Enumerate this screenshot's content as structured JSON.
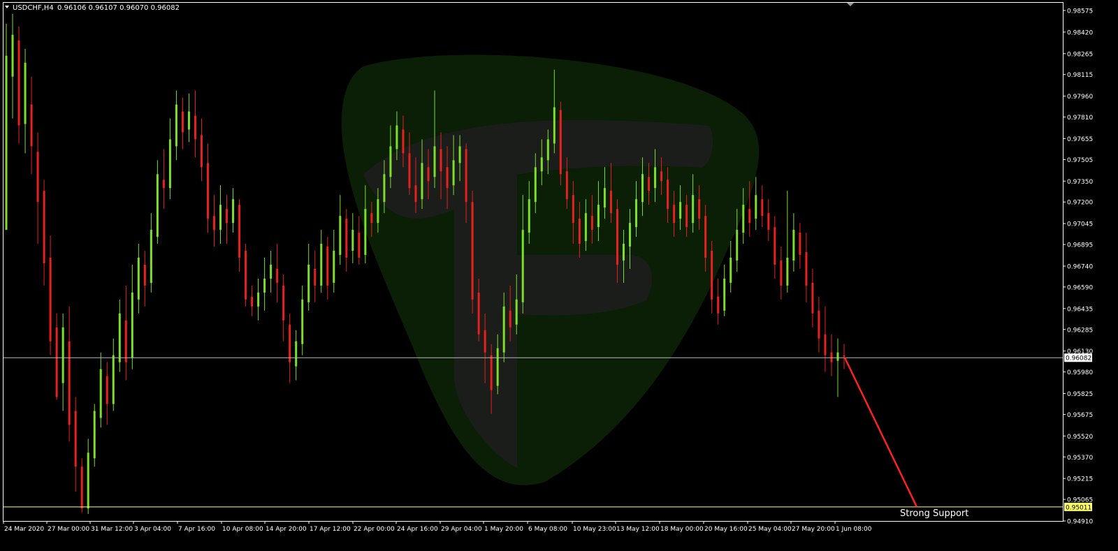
{
  "header": {
    "symbol_timeframe": "USDCHF,H4",
    "ohlc": "0.96106 0.96107 0.96070 0.96082"
  },
  "colors": {
    "background": "#000000",
    "frame": "#ffffff",
    "text": "#ffffff",
    "bull": "#7ddf2c",
    "bear": "#e8201e",
    "bid_line": "#b8b8b8",
    "support_line": "#ffff66",
    "projection": "#ff2020",
    "watermark_shield": "#0b2207",
    "watermark_letter": "#1d1d1d"
  },
  "watermark": {
    "icon": "shield-p-logo-icon"
  },
  "chart_data": {
    "type": "candlestick",
    "symbol": "USDCHF",
    "timeframe": "H4",
    "ylim": [
      0.9491,
      0.98575
    ],
    "y_ticks": [
      "0.98575",
      "0.98420",
      "0.98265",
      "0.98115",
      "0.97960",
      "0.97810",
      "0.97655",
      "0.97505",
      "0.97350",
      "0.97200",
      "0.97045",
      "0.96895",
      "0.96740",
      "0.96590",
      "0.96435",
      "0.96285",
      "0.96130",
      "0.95980",
      "0.95825",
      "0.95675",
      "0.95520",
      "0.95370",
      "0.95215",
      "0.95065",
      "0.94910"
    ],
    "x_labels": [
      "24 Mar 2020",
      "27 Mar 00:00",
      "31 Mar 12:00",
      "3 Apr 04:00",
      "7 Apr 16:00",
      "10 Apr 08:00",
      "14 Apr 20:00",
      "17 Apr 12:00",
      "22 Apr 00:00",
      "24 Apr 16:00",
      "29 Apr 04:00",
      "1 May 20:00",
      "6 May 08:00",
      "10 May 23:00",
      "13 May 12:00",
      "18 May 00:00",
      "20 May 16:00",
      "25 May 04:00",
      "27 May 20:00",
      "1 Jun 08:00"
    ],
    "bid_price": "0.96082",
    "support_price": "0.95011",
    "support_label": "Strong Support",
    "projection": {
      "from_price": 0.96082,
      "to_price": 0.95011
    },
    "candles": [
      [
        0.97,
        0.9825,
        0.9725,
        0.9848,
        0.9712
      ],
      [
        0.981,
        0.984,
        0.9794,
        0.9855,
        0.978
      ],
      [
        0.9836,
        0.9775,
        0.9786,
        0.9846,
        0.9762
      ],
      [
        0.9776,
        0.982,
        0.976,
        0.983,
        0.9755
      ],
      [
        0.979,
        0.976,
        0.9745,
        0.981,
        0.974
      ],
      [
        0.9756,
        0.972,
        0.9705,
        0.977,
        0.969
      ],
      [
        0.9728,
        0.9676,
        0.9688,
        0.9736,
        0.966
      ],
      [
        0.968,
        0.962,
        0.9632,
        0.9696,
        0.961
      ],
      [
        0.963,
        0.958,
        0.9592,
        0.964,
        0.9578
      ],
      [
        0.959,
        0.963,
        0.9615,
        0.964,
        0.957
      ],
      [
        0.962,
        0.956,
        0.9575,
        0.9645,
        0.9548
      ],
      [
        0.957,
        0.953,
        0.9518,
        0.958,
        0.9512
      ],
      [
        0.953,
        0.95,
        0.9505,
        0.9536,
        0.9497
      ],
      [
        0.95,
        0.954,
        0.9528,
        0.955,
        0.9496
      ],
      [
        0.9536,
        0.957,
        0.956,
        0.9575,
        0.953
      ],
      [
        0.9565,
        0.96,
        0.959,
        0.9612,
        0.9558
      ],
      [
        0.9595,
        0.9575,
        0.9568,
        0.9605,
        0.956
      ],
      [
        0.9575,
        0.961,
        0.9598,
        0.9622,
        0.957
      ],
      [
        0.9605,
        0.964,
        0.9628,
        0.965,
        0.9598
      ],
      [
        0.9635,
        0.9605,
        0.9595,
        0.966,
        0.9592
      ],
      [
        0.9608,
        0.9655,
        0.964,
        0.9675,
        0.96
      ],
      [
        0.965,
        0.968,
        0.9668,
        0.969,
        0.964
      ],
      [
        0.9675,
        0.966,
        0.965,
        0.9685,
        0.9645
      ],
      [
        0.9662,
        0.97,
        0.9688,
        0.9712,
        0.9655
      ],
      [
        0.9695,
        0.974,
        0.9728,
        0.975,
        0.969
      ],
      [
        0.9736,
        0.973,
        0.972,
        0.9758,
        0.9715
      ],
      [
        0.973,
        0.9765,
        0.9752,
        0.978,
        0.9722
      ],
      [
        0.976,
        0.979,
        0.978,
        0.98,
        0.975
      ],
      [
        0.9785,
        0.977,
        0.976,
        0.9795,
        0.9758
      ],
      [
        0.9772,
        0.9785,
        0.979,
        0.9798,
        0.9763
      ],
      [
        0.9782,
        0.9765,
        0.9772,
        0.98,
        0.9752
      ],
      [
        0.9768,
        0.9745,
        0.9738,
        0.978,
        0.9735
      ],
      [
        0.9748,
        0.9708,
        0.9718,
        0.9762,
        0.9698
      ],
      [
        0.971,
        0.97,
        0.9692,
        0.9725,
        0.9688
      ],
      [
        0.97,
        0.9718,
        0.9708,
        0.9732,
        0.969
      ],
      [
        0.9715,
        0.9705,
        0.9698,
        0.9725,
        0.969
      ],
      [
        0.9705,
        0.9722,
        0.9712,
        0.973,
        0.9698
      ],
      [
        0.9718,
        0.968,
        0.9692,
        0.9722,
        0.967
      ],
      [
        0.9685,
        0.965,
        0.9658,
        0.969,
        0.9645
      ],
      [
        0.9652,
        0.9645,
        0.964,
        0.966,
        0.9638
      ],
      [
        0.9645,
        0.9655,
        0.965,
        0.9665,
        0.9635
      ],
      [
        0.9655,
        0.9665,
        0.966,
        0.968,
        0.9642
      ],
      [
        0.9665,
        0.9675,
        0.9668,
        0.9685,
        0.9655
      ],
      [
        0.9672,
        0.9662,
        0.9655,
        0.969,
        0.9648
      ],
      [
        0.966,
        0.9635,
        0.9625,
        0.9668,
        0.962
      ],
      [
        0.9632,
        0.9605,
        0.9595,
        0.964,
        0.959
      ],
      [
        0.9602,
        0.962,
        0.9612,
        0.9628,
        0.9592
      ],
      [
        0.9618,
        0.965,
        0.964,
        0.966,
        0.961
      ],
      [
        0.9648,
        0.9675,
        0.9668,
        0.969,
        0.9642
      ],
      [
        0.9672,
        0.966,
        0.9652,
        0.9685,
        0.9648
      ],
      [
        0.966,
        0.969,
        0.9682,
        0.97,
        0.9655
      ],
      [
        0.9688,
        0.966,
        0.9668,
        0.9695,
        0.965
      ],
      [
        0.9662,
        0.9685,
        0.9678,
        0.97,
        0.9655
      ],
      [
        0.9682,
        0.971,
        0.97,
        0.9725,
        0.9675
      ],
      [
        0.9708,
        0.968,
        0.969,
        0.9715,
        0.967
      ],
      [
        0.9685,
        0.97,
        0.9692,
        0.9712,
        0.9676
      ],
      [
        0.9698,
        0.968,
        0.9688,
        0.971,
        0.9675
      ],
      [
        0.9682,
        0.9715,
        0.9705,
        0.9732,
        0.9676
      ],
      [
        0.9712,
        0.9705,
        0.97,
        0.972,
        0.9695
      ],
      [
        0.9705,
        0.9722,
        0.9715,
        0.973,
        0.9698
      ],
      [
        0.972,
        0.974,
        0.9732,
        0.975,
        0.9712
      ],
      [
        0.9738,
        0.976,
        0.9752,
        0.9775,
        0.973
      ],
      [
        0.9758,
        0.9775,
        0.9768,
        0.9785,
        0.975
      ],
      [
        0.9772,
        0.9755,
        0.9762,
        0.9782,
        0.9745
      ],
      [
        0.9755,
        0.973,
        0.974,
        0.977,
        0.9725
      ],
      [
        0.9732,
        0.972,
        0.9725,
        0.9752,
        0.9712
      ],
      [
        0.9722,
        0.9748,
        0.974,
        0.9765,
        0.9715
      ],
      [
        0.9745,
        0.9735,
        0.9728,
        0.9758,
        0.9722
      ],
      [
        0.9738,
        0.976,
        0.9752,
        0.98,
        0.973
      ],
      [
        0.9758,
        0.9742,
        0.9735,
        0.977,
        0.9722
      ],
      [
        0.9745,
        0.973,
        0.972,
        0.976,
        0.9715
      ],
      [
        0.9732,
        0.975,
        0.9742,
        0.9768,
        0.9725
      ],
      [
        0.9748,
        0.976,
        0.975,
        0.9768,
        0.9735
      ],
      [
        0.9758,
        0.972,
        0.973,
        0.9762,
        0.9705
      ],
      [
        0.972,
        0.965,
        0.9665,
        0.9728,
        0.964
      ],
      [
        0.9655,
        0.9625,
        0.963,
        0.9665,
        0.962
      ],
      [
        0.9628,
        0.9612,
        0.9605,
        0.964,
        0.959
      ],
      [
        0.961,
        0.9585,
        0.9592,
        0.9618,
        0.9568
      ],
      [
        0.9588,
        0.9615,
        0.9605,
        0.9625,
        0.9582
      ],
      [
        0.9612,
        0.9645,
        0.9635,
        0.9655,
        0.9605
      ],
      [
        0.9642,
        0.963,
        0.9625,
        0.966,
        0.962
      ],
      [
        0.9632,
        0.965,
        0.9642,
        0.9668,
        0.9625
      ],
      [
        0.9648,
        0.97,
        0.969,
        0.9725,
        0.964
      ],
      [
        0.9698,
        0.9722,
        0.9715,
        0.9735,
        0.969
      ],
      [
        0.972,
        0.9745,
        0.9735,
        0.9755,
        0.9712
      ],
      [
        0.9742,
        0.9752,
        0.9745,
        0.9765,
        0.9732
      ],
      [
        0.975,
        0.9765,
        0.9755,
        0.9772,
        0.974
      ],
      [
        0.9762,
        0.9788,
        0.978,
        0.9815,
        0.9755
      ],
      [
        0.9786,
        0.974,
        0.9755,
        0.9792,
        0.9732
      ],
      [
        0.9742,
        0.9722,
        0.973,
        0.9752,
        0.9715
      ],
      [
        0.9725,
        0.9705,
        0.9712,
        0.9735,
        0.969
      ],
      [
        0.9708,
        0.969,
        0.9698,
        0.972,
        0.968
      ],
      [
        0.9692,
        0.9712,
        0.9705,
        0.9722,
        0.9685
      ],
      [
        0.971,
        0.97,
        0.9695,
        0.9725,
        0.969
      ],
      [
        0.9702,
        0.9718,
        0.971,
        0.9735,
        0.9692
      ],
      [
        0.9716,
        0.973,
        0.9722,
        0.9745,
        0.9708
      ],
      [
        0.9728,
        0.9712,
        0.9718,
        0.9748,
        0.9705
      ],
      [
        0.9715,
        0.9675,
        0.9688,
        0.9722,
        0.9662
      ],
      [
        0.9678,
        0.969,
        0.9682,
        0.97,
        0.9662
      ],
      [
        0.9688,
        0.9705,
        0.9698,
        0.9715,
        0.9672
      ],
      [
        0.9702,
        0.9722,
        0.9715,
        0.9735,
        0.9695
      ],
      [
        0.972,
        0.974,
        0.9732,
        0.9752,
        0.971
      ],
      [
        0.9738,
        0.9728,
        0.9725,
        0.9748,
        0.9718
      ],
      [
        0.973,
        0.9745,
        0.9738,
        0.9758,
        0.972
      ],
      [
        0.9742,
        0.9735,
        0.973,
        0.9752,
        0.9725
      ],
      [
        0.9736,
        0.9715,
        0.9722,
        0.9745,
        0.9705
      ],
      [
        0.9718,
        0.9705,
        0.971,
        0.9728,
        0.9695
      ],
      [
        0.9708,
        0.972,
        0.9712,
        0.9732,
        0.97
      ],
      [
        0.9718,
        0.9702,
        0.971,
        0.9725,
        0.9695
      ],
      [
        0.9705,
        0.9725,
        0.9718,
        0.974,
        0.9698
      ],
      [
        0.9722,
        0.9708,
        0.9715,
        0.9732,
        0.97
      ],
      [
        0.971,
        0.968,
        0.9692,
        0.9718,
        0.967
      ],
      [
        0.9685,
        0.965,
        0.9662,
        0.9692,
        0.964
      ],
      [
        0.9652,
        0.964,
        0.9645,
        0.9665,
        0.9632
      ],
      [
        0.9642,
        0.9665,
        0.9658,
        0.9675,
        0.9638
      ],
      [
        0.9662,
        0.968,
        0.9672,
        0.9692,
        0.9655
      ],
      [
        0.9678,
        0.97,
        0.9692,
        0.9715,
        0.967
      ],
      [
        0.9698,
        0.9718,
        0.971,
        0.973,
        0.969
      ],
      [
        0.9715,
        0.9705,
        0.97,
        0.9735,
        0.9695
      ],
      [
        0.9708,
        0.9725,
        0.9718,
        0.9738,
        0.97
      ],
      [
        0.9722,
        0.971,
        0.9715,
        0.9732,
        0.9702
      ],
      [
        0.9712,
        0.97,
        0.9705,
        0.9722,
        0.9692
      ],
      [
        0.9702,
        0.9675,
        0.9685,
        0.971,
        0.9665
      ],
      [
        0.9678,
        0.966,
        0.9668,
        0.9688,
        0.965
      ],
      [
        0.966,
        0.968,
        0.9672,
        0.9728,
        0.9655
      ],
      [
        0.9678,
        0.97,
        0.9692,
        0.9712,
        0.967
      ],
      [
        0.9698,
        0.9682,
        0.969,
        0.9705,
        0.9672
      ],
      [
        0.9684,
        0.966,
        0.9668,
        0.9698,
        0.9648
      ],
      [
        0.9662,
        0.964,
        0.9648,
        0.9672,
        0.963
      ],
      [
        0.9642,
        0.9622,
        0.963,
        0.9652,
        0.9612
      ],
      [
        0.9625,
        0.961,
        0.9615,
        0.9645,
        0.9598
      ],
      [
        0.9612,
        0.9605,
        0.9598,
        0.9625,
        0.9595
      ],
      [
        0.9606,
        0.9612,
        0.9608,
        0.9622,
        0.958
      ],
      [
        0.961,
        0.9609,
        0.9606,
        0.9618,
        0.96
      ]
    ]
  }
}
